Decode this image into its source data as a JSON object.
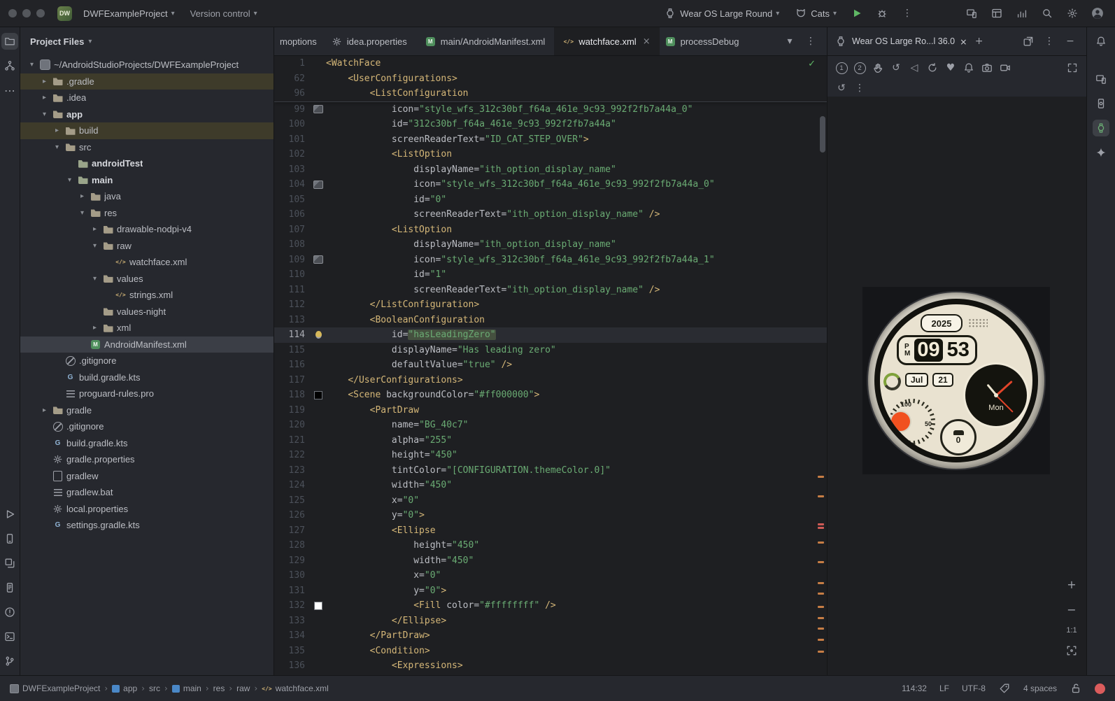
{
  "colors": {
    "accent_green": "#5fb865",
    "error_red": "#db5c5c",
    "warning_orange": "#c77d45",
    "selection_gray": "#3b3e46",
    "excluded_olive": "#3e3b2a"
  },
  "glyphs": {
    "chevron_down": "▾",
    "chevron_right": "▸",
    "kebab": "⋮",
    "more": "⋯",
    "back": "◁",
    "heart": "♥",
    "rotate": "↺",
    "check": "✓",
    "plus": "+",
    "minus": "−",
    "close": "×",
    "separator": "›"
  },
  "topbar": {
    "project_badge": "DW",
    "project_name": "DWFExampleProject",
    "version_control_label": "Version control",
    "device_selector_label": "Wear OS Large Round",
    "run_config_label": "Cats"
  },
  "project_panel": {
    "title": "Project Files",
    "tree": [
      {
        "label": "~/AndroidStudioProjects/DWFExampleProject",
        "level": 0,
        "icon": "project",
        "twisty": "open"
      },
      {
        "label": ".gradle",
        "level": 1,
        "icon": "folder",
        "twisty": "closed",
        "highlight": "excluded"
      },
      {
        "label": ".idea",
        "level": 1,
        "icon": "folder",
        "twisty": "closed"
      },
      {
        "label": "app",
        "level": 1,
        "icon": "module",
        "twisty": "open",
        "bold": true
      },
      {
        "label": "build",
        "level": 2,
        "icon": "folder",
        "twisty": "closed",
        "highlight": "excluded"
      },
      {
        "label": "src",
        "level": 2,
        "icon": "folder",
        "twisty": "open"
      },
      {
        "label": "androidTest",
        "level": 3,
        "icon": "source",
        "bold": true
      },
      {
        "label": "main",
        "level": 3,
        "icon": "source",
        "twisty": "open",
        "bold": true
      },
      {
        "label": "java",
        "level": 4,
        "icon": "folder",
        "twisty": "closed"
      },
      {
        "label": "res",
        "level": 4,
        "icon": "folder",
        "twisty": "open"
      },
      {
        "label": "drawable-nodpi-v4",
        "level": 5,
        "icon": "folder",
        "twisty": "closed"
      },
      {
        "label": "raw",
        "level": 5,
        "icon": "folder",
        "twisty": "open"
      },
      {
        "label": "watchface.xml",
        "level": 6,
        "icon": "xml"
      },
      {
        "label": "values",
        "level": 5,
        "icon": "folder",
        "twisty": "open"
      },
      {
        "label": "strings.xml",
        "level": 6,
        "icon": "xml"
      },
      {
        "label": "values-night",
        "level": 5,
        "icon": "folder"
      },
      {
        "label": "xml",
        "level": 5,
        "icon": "folder",
        "twisty": "closed"
      },
      {
        "label": "AndroidManifest.xml",
        "level": 4,
        "icon": "manifest",
        "highlight": "selected"
      },
      {
        "label": ".gitignore",
        "level": 2,
        "icon": "gitignore"
      },
      {
        "label": "build.gradle.kts",
        "level": 2,
        "icon": "gradle"
      },
      {
        "label": "proguard-rules.pro",
        "level": 2,
        "icon": "text"
      },
      {
        "label": "gradle",
        "level": 1,
        "icon": "folder",
        "twisty": "closed"
      },
      {
        "label": ".gitignore",
        "level": 1,
        "icon": "gitignore"
      },
      {
        "label": "build.gradle.kts",
        "level": 1,
        "icon": "gradle"
      },
      {
        "label": "gradle.properties",
        "level": 1,
        "icon": "properties"
      },
      {
        "label": "gradlew",
        "level": 1,
        "icon": "file"
      },
      {
        "label": "gradlew.bat",
        "level": 1,
        "icon": "text"
      },
      {
        "label": "local.properties",
        "level": 1,
        "icon": "properties"
      },
      {
        "label": "settings.gradle.kts",
        "level": 1,
        "icon": "gradle"
      }
    ]
  },
  "editor": {
    "tabs": [
      {
        "label": "moptions",
        "icon": null,
        "truncated": true
      },
      {
        "label": "idea.properties",
        "icon": "properties"
      },
      {
        "label": "main/AndroidManifest.xml",
        "icon": "manifest"
      },
      {
        "label": "watchface.xml",
        "icon": "xml",
        "active": true,
        "closable": true
      },
      {
        "label": "processDebug",
        "icon": "manifest",
        "truncated": true
      }
    ],
    "caret_word": "hasLeadingZero",
    "sticky_lines": [
      {
        "n": "1",
        "ind": 0,
        "seg": [
          [
            "t",
            "<WatchFace"
          ]
        ]
      },
      {
        "n": "62",
        "ind": 4,
        "seg": [
          [
            "t",
            "<UserConfigurations>"
          ]
        ]
      },
      {
        "n": "96",
        "ind": 8,
        "seg": [
          [
            "t",
            "<ListConfiguration"
          ]
        ]
      }
    ],
    "lines": [
      {
        "n": "99",
        "ind": 12,
        "g": "img",
        "seg": [
          [
            "a",
            "icon="
          ],
          [
            "v",
            "\"style_wfs_312c30bf_f64a_461e_9c93_992f2fb7a44a_0\""
          ]
        ]
      },
      {
        "n": "100",
        "ind": 12,
        "seg": [
          [
            "a",
            "id="
          ],
          [
            "v",
            "\"312c30bf_f64a_461e_9c93_992f2fb7a44a\""
          ]
        ]
      },
      {
        "n": "101",
        "ind": 12,
        "seg": [
          [
            "a",
            "screenReaderText="
          ],
          [
            "v",
            "\"ID_CAT_STEP_OVER\""
          ],
          [
            "t",
            ">"
          ]
        ]
      },
      {
        "n": "102",
        "ind": 12,
        "seg": [
          [
            "t",
            "<ListOption"
          ]
        ]
      },
      {
        "n": "103",
        "ind": 16,
        "seg": [
          [
            "a",
            "displayName="
          ],
          [
            "v",
            "\"ith_option_display_name\""
          ]
        ]
      },
      {
        "n": "104",
        "ind": 16,
        "g": "img",
        "seg": [
          [
            "a",
            "icon="
          ],
          [
            "v",
            "\"style_wfs_312c30bf_f64a_461e_9c93_992f2fb7a44a_0\""
          ]
        ]
      },
      {
        "n": "105",
        "ind": 16,
        "seg": [
          [
            "a",
            "id="
          ],
          [
            "v",
            "\"0\""
          ]
        ]
      },
      {
        "n": "106",
        "ind": 16,
        "seg": [
          [
            "a",
            "screenReaderText="
          ],
          [
            "v",
            "\"ith_option_display_name\""
          ],
          [
            "t",
            " />"
          ]
        ]
      },
      {
        "n": "107",
        "ind": 12,
        "seg": [
          [
            "t",
            "<ListOption"
          ]
        ]
      },
      {
        "n": "108",
        "ind": 16,
        "seg": [
          [
            "a",
            "displayName="
          ],
          [
            "v",
            "\"ith_option_display_name\""
          ]
        ]
      },
      {
        "n": "109",
        "ind": 16,
        "g": "img",
        "seg": [
          [
            "a",
            "icon="
          ],
          [
            "v",
            "\"style_wfs_312c30bf_f64a_461e_9c93_992f2fb7a44a_1\""
          ]
        ]
      },
      {
        "n": "110",
        "ind": 16,
        "seg": [
          [
            "a",
            "id="
          ],
          [
            "v",
            "\"1\""
          ]
        ]
      },
      {
        "n": "111",
        "ind": 16,
        "seg": [
          [
            "a",
            "screenReaderText="
          ],
          [
            "v",
            "\"ith_option_display_name\""
          ],
          [
            "t",
            " />"
          ]
        ]
      },
      {
        "n": "112",
        "ind": 8,
        "seg": [
          [
            "t",
            "</ListConfiguration>"
          ]
        ]
      },
      {
        "n": "113",
        "ind": 8,
        "seg": [
          [
            "t",
            "<BooleanConfiguration"
          ]
        ]
      },
      {
        "n": "114",
        "ind": 12,
        "g": "bulb",
        "cur": true,
        "seg": [
          [
            "a",
            "id="
          ],
          [
            "s",
            "\"hasLeadingZero\""
          ]
        ]
      },
      {
        "n": "115",
        "ind": 12,
        "seg": [
          [
            "a",
            "displayName="
          ],
          [
            "v",
            "\"Has leading zero\""
          ]
        ]
      },
      {
        "n": "116",
        "ind": 12,
        "seg": [
          [
            "a",
            "defaultValue="
          ],
          [
            "v",
            "\"true\""
          ],
          [
            "t",
            " />"
          ]
        ]
      },
      {
        "n": "117",
        "ind": 4,
        "seg": [
          [
            "t",
            "</UserConfigurations>"
          ]
        ]
      },
      {
        "n": "118",
        "ind": 4,
        "g": "swatch-black",
        "seg": [
          [
            "t",
            "<Scene "
          ],
          [
            "a",
            "backgroundColor="
          ],
          [
            "v",
            "\"#ff000000\""
          ],
          [
            "t",
            ">"
          ]
        ]
      },
      {
        "n": "119",
        "ind": 8,
        "seg": [
          [
            "t",
            "<PartDraw"
          ]
        ]
      },
      {
        "n": "120",
        "ind": 12,
        "seg": [
          [
            "a",
            "name="
          ],
          [
            "v",
            "\"BG_40c7\""
          ]
        ]
      },
      {
        "n": "121",
        "ind": 12,
        "seg": [
          [
            "a",
            "alpha="
          ],
          [
            "v",
            "\"255\""
          ]
        ]
      },
      {
        "n": "122",
        "ind": 12,
        "seg": [
          [
            "a",
            "height="
          ],
          [
            "v",
            "\"450\""
          ]
        ]
      },
      {
        "n": "123",
        "ind": 12,
        "seg": [
          [
            "a",
            "tintColor="
          ],
          [
            "v",
            "\"[CONFIGURATION.themeColor.0]\""
          ]
        ]
      },
      {
        "n": "124",
        "ind": 12,
        "seg": [
          [
            "a",
            "width="
          ],
          [
            "v",
            "\"450\""
          ]
        ]
      },
      {
        "n": "125",
        "ind": 12,
        "seg": [
          [
            "a",
            "x="
          ],
          [
            "v",
            "\"0\""
          ]
        ]
      },
      {
        "n": "126",
        "ind": 12,
        "seg": [
          [
            "a",
            "y="
          ],
          [
            "v",
            "\"0\""
          ],
          [
            "t",
            ">"
          ]
        ]
      },
      {
        "n": "127",
        "ind": 12,
        "seg": [
          [
            "t",
            "<Ellipse"
          ]
        ]
      },
      {
        "n": "128",
        "ind": 16,
        "seg": [
          [
            "a",
            "height="
          ],
          [
            "v",
            "\"450\""
          ]
        ]
      },
      {
        "n": "129",
        "ind": 16,
        "seg": [
          [
            "a",
            "width="
          ],
          [
            "v",
            "\"450\""
          ]
        ]
      },
      {
        "n": "130",
        "ind": 16,
        "seg": [
          [
            "a",
            "x="
          ],
          [
            "v",
            "\"0\""
          ]
        ]
      },
      {
        "n": "131",
        "ind": 16,
        "seg": [
          [
            "a",
            "y="
          ],
          [
            "v",
            "\"0\""
          ],
          [
            "t",
            ">"
          ]
        ]
      },
      {
        "n": "132",
        "ind": 16,
        "g": "swatch-white",
        "seg": [
          [
            "t",
            "<Fill "
          ],
          [
            "a",
            "color="
          ],
          [
            "v",
            "\"#ffffffff\""
          ],
          [
            "t",
            " />"
          ]
        ]
      },
      {
        "n": "133",
        "ind": 12,
        "seg": [
          [
            "t",
            "</Ellipse>"
          ]
        ]
      },
      {
        "n": "134",
        "ind": 8,
        "seg": [
          [
            "t",
            "</PartDraw>"
          ]
        ]
      },
      {
        "n": "135",
        "ind": 8,
        "seg": [
          [
            "t",
            "<Condition>"
          ]
        ]
      },
      {
        "n": "136",
        "ind": 12,
        "seg": [
          [
            "t",
            "<Expressions>"
          ]
        ]
      }
    ]
  },
  "running_devices": {
    "tab_label": "Wear OS Large Ro...l 36.0",
    "zoom_ratio": "1:1",
    "hw_button_1": "1",
    "hw_button_2": "2",
    "watch": {
      "year": "2025",
      "meridiem_top": "P",
      "meridiem_bottom": "M",
      "hours": "09",
      "minutes": "53",
      "month": "Jul",
      "day": "21",
      "weekday": "Mon",
      "gauge_max": "100",
      "gauge_mid": "50",
      "gauge_min": "0",
      "counter": "0"
    }
  },
  "status_bar": {
    "breadcrumbs": [
      {
        "label": "DWFExampleProject",
        "icon": "project"
      },
      {
        "label": "app",
        "icon": "module"
      },
      {
        "label": "src"
      },
      {
        "label": "main",
        "icon": "module"
      },
      {
        "label": "res"
      },
      {
        "label": "raw"
      },
      {
        "label": "watchface.xml",
        "icon": "xml"
      }
    ],
    "caret_position": "114:32",
    "line_separator": "LF",
    "encoding": "UTF-8",
    "indent_style": "4 spaces"
  }
}
